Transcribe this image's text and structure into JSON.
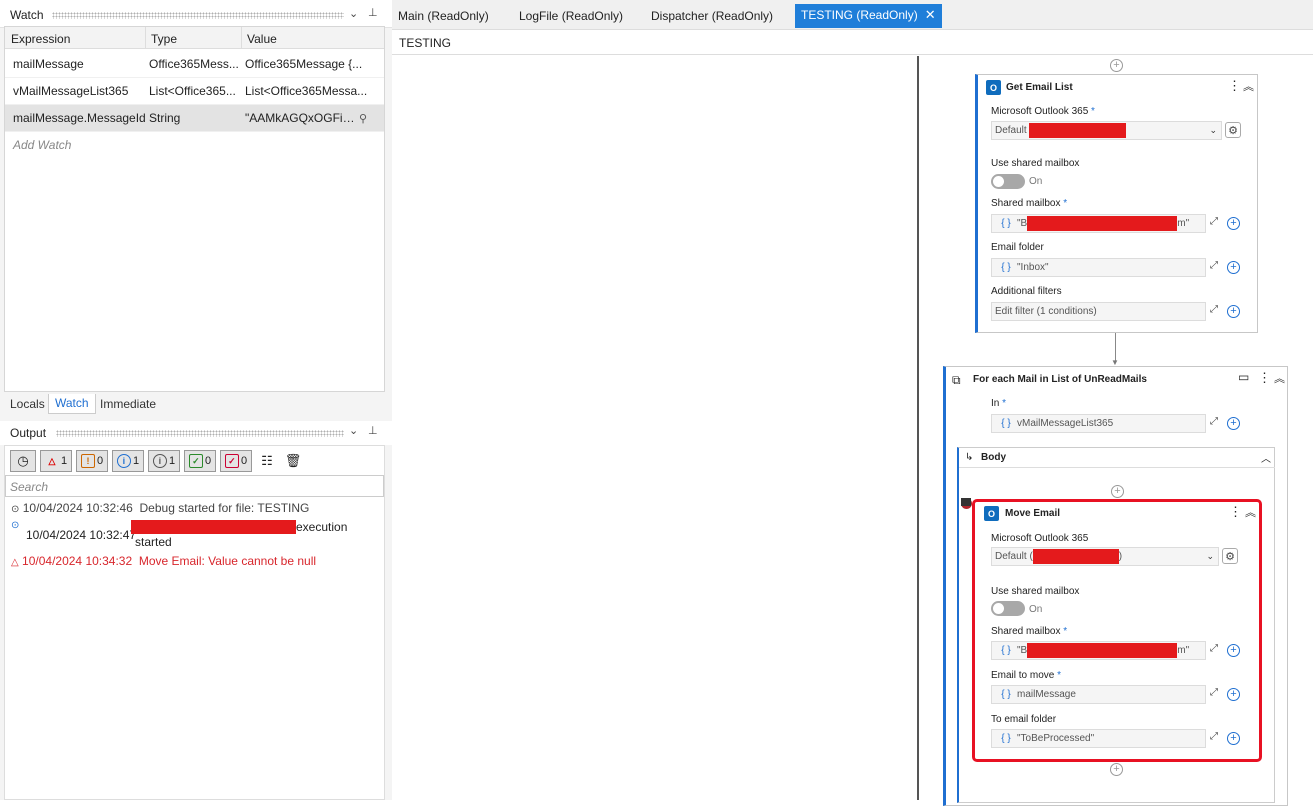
{
  "watch": {
    "title": "Watch",
    "columns": [
      "Expression",
      "Type",
      "Value"
    ],
    "rows": [
      {
        "expr": "mailMessage",
        "type": "Office365Mess...",
        "value": "Office365Message {..."
      },
      {
        "expr": "vMailMessageList365",
        "type": "List<Office365...",
        "value": "List<Office365Messa..."
      },
      {
        "expr": "mailMessage.MessageId",
        "type": "String",
        "value": "\"AAMkAGQxOGFiM..."
      }
    ],
    "add": "Add Watch"
  },
  "bottom_tabs": [
    "Locals",
    "Watch",
    "Immediate"
  ],
  "output": {
    "title": "Output",
    "filters": [
      "1",
      "0",
      "1",
      "1",
      "0",
      "0"
    ],
    "search_placeholder": "Search",
    "lines": [
      {
        "time": "10/04/2024 10:32:46",
        "text": "Debug started for file: TESTING"
      },
      {
        "time": "10/04/2024 10:32:47",
        "text": "execution",
        "cont": "started"
      },
      {
        "time": "10/04/2024 10:34:32",
        "text": "Move Email: Value cannot be null"
      }
    ]
  },
  "doc_tabs": [
    "Main (ReadOnly)",
    "LogFile (ReadOnly)",
    "Dispatcher (ReadOnly)",
    "TESTING (ReadOnly)"
  ],
  "breadcrumb": "TESTING",
  "get_email": {
    "title": "Get Email List",
    "f1": "Microsoft Outlook 365",
    "f1v": "Default",
    "f2": "Use shared mailbox",
    "on": "On",
    "f3": "Shared mailbox",
    "f3v_start": "\"B",
    "f3v_end": "m\"",
    "f4": "Email folder",
    "f4v": "\"Inbox\"",
    "f5": "Additional filters",
    "f5v": "Edit filter (1 conditions)"
  },
  "foreach": {
    "title": "For each Mail in List of UnReadMails",
    "in": "In",
    "inv": "vMailMessageList365",
    "body": "Body"
  },
  "move": {
    "title": "Move Email",
    "f1": "Microsoft Outlook 365",
    "f1v": "Default (",
    "f1v_end": ")",
    "f2": "Use shared mailbox",
    "on": "On",
    "f3": "Shared mailbox",
    "f3v_start": "\"B",
    "f3v_end": "m\"",
    "f4": "Email to move",
    "f4v": "mailMessage",
    "f5": "To email folder",
    "f5v": "\"ToBeProcessed\""
  },
  "colors": {
    "accent": "#1f7ed9",
    "error": "#e41a1c",
    "highlight": "#e81123"
  }
}
